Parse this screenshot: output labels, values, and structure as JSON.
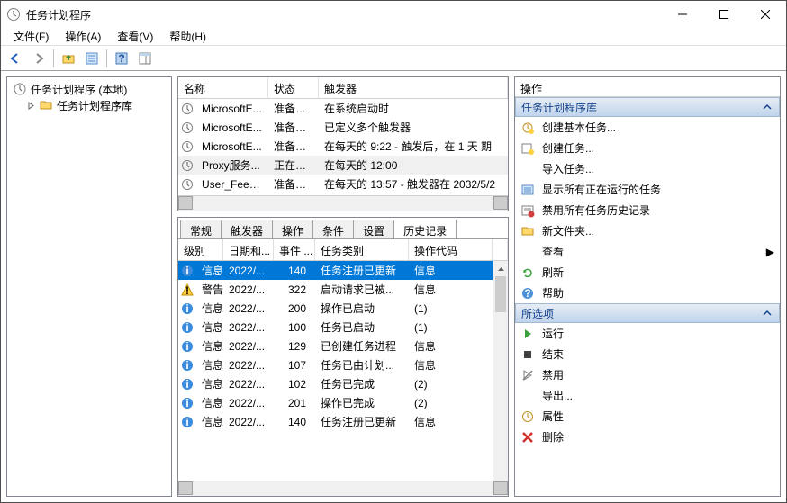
{
  "title": "任务计划程序",
  "menu": [
    "文件(F)",
    "操作(A)",
    "查看(V)",
    "帮助(H)"
  ],
  "tree": {
    "root": "任务计划程序 (本地)",
    "child": "任务计划程序库"
  },
  "list": {
    "cols": [
      "名称",
      "状态",
      "触发器"
    ],
    "rows": [
      {
        "name": "MicrosoftE...",
        "state": "准备就绪",
        "trigger": "在系统启动时"
      },
      {
        "name": "MicrosoftE...",
        "state": "准备就绪",
        "trigger": "已定义多个触发器"
      },
      {
        "name": "MicrosoftE...",
        "state": "准备就绪",
        "trigger": "在每天的 9:22 - 触发后，在 1 天 期"
      },
      {
        "name": "Proxy服务...",
        "state": "正在运行",
        "trigger": "在每天的 12:00",
        "sel": true
      },
      {
        "name": "User_Feed_...",
        "state": "准备就绪",
        "trigger": "在每天的 13:57 - 触发器在 2032/5/2"
      }
    ]
  },
  "tabs": [
    "常规",
    "触发器",
    "操作",
    "条件",
    "设置",
    "历史记录"
  ],
  "activeTab": 5,
  "history": {
    "cols": [
      "级别",
      "日期和...",
      "事件 ...",
      "任务类别",
      "操作代码"
    ],
    "rows": [
      {
        "level": "信息",
        "date": "2022/...",
        "evt": "140",
        "cat": "任务注册已更新",
        "op": "信息",
        "sel": true,
        "icon": "info"
      },
      {
        "level": "警告",
        "date": "2022/...",
        "evt": "322",
        "cat": "启动请求已被...",
        "op": "信息",
        "icon": "warn"
      },
      {
        "level": "信息",
        "date": "2022/...",
        "evt": "200",
        "cat": "操作已启动",
        "op": "(1)",
        "icon": "info"
      },
      {
        "level": "信息",
        "date": "2022/...",
        "evt": "100",
        "cat": "任务已启动",
        "op": "(1)",
        "icon": "info"
      },
      {
        "level": "信息",
        "date": "2022/...",
        "evt": "129",
        "cat": "已创建任务进程",
        "op": "信息",
        "icon": "info"
      },
      {
        "level": "信息",
        "date": "2022/...",
        "evt": "107",
        "cat": "任务已由计划...",
        "op": "信息",
        "icon": "info"
      },
      {
        "level": "信息",
        "date": "2022/...",
        "evt": "102",
        "cat": "任务已完成",
        "op": "(2)",
        "icon": "info"
      },
      {
        "level": "信息",
        "date": "2022/...",
        "evt": "201",
        "cat": "操作已完成",
        "op": "(2)",
        "icon": "info"
      },
      {
        "level": "信息",
        "date": "2022/...",
        "evt": "140",
        "cat": "任务注册已更新",
        "op": "信息",
        "icon": "info"
      }
    ]
  },
  "actions": {
    "title": "操作",
    "section1": "任务计划程序库",
    "items1": [
      {
        "icon": "new-basic",
        "label": "创建基本任务..."
      },
      {
        "icon": "new-task",
        "label": "创建任务..."
      },
      {
        "icon": "",
        "label": "导入任务..."
      },
      {
        "icon": "running",
        "label": "显示所有正在运行的任务"
      },
      {
        "icon": "disable-hist",
        "label": "禁用所有任务历史记录"
      },
      {
        "icon": "folder",
        "label": "新文件夹..."
      },
      {
        "icon": "",
        "label": "查看",
        "arrow": true
      },
      {
        "icon": "refresh",
        "label": "刷新"
      },
      {
        "icon": "help",
        "label": "帮助"
      }
    ],
    "section2": "所选项",
    "items2": [
      {
        "icon": "run",
        "label": "运行"
      },
      {
        "icon": "stop",
        "label": "结束"
      },
      {
        "icon": "disable",
        "label": "禁用"
      },
      {
        "icon": "",
        "label": "导出..."
      },
      {
        "icon": "props",
        "label": "属性"
      },
      {
        "icon": "delete",
        "label": "删除"
      }
    ]
  }
}
